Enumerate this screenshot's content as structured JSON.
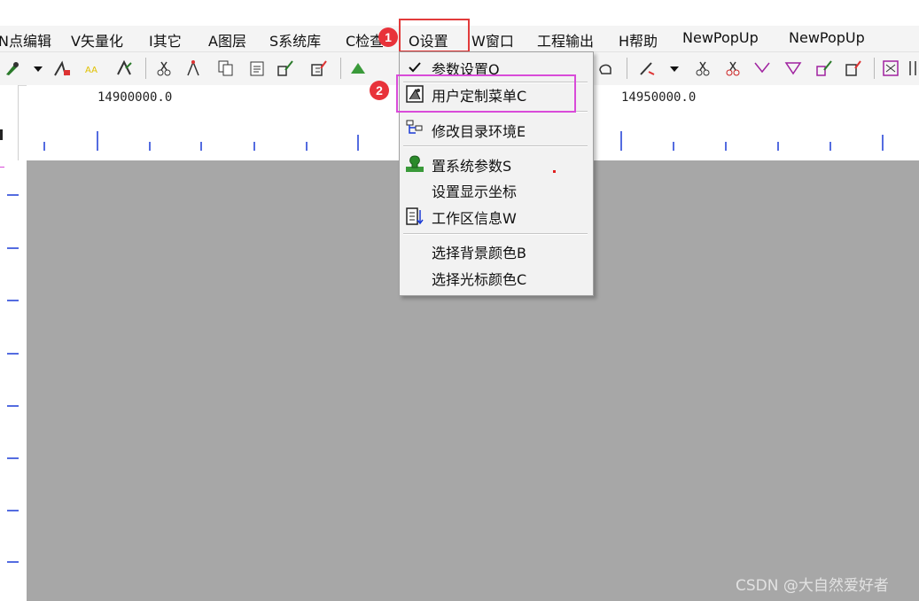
{
  "menubar": {
    "items": [
      {
        "label": "N点编辑"
      },
      {
        "label": "V矢量化"
      },
      {
        "label": "I其它"
      },
      {
        "label": "A图层"
      },
      {
        "label": "S系统库"
      },
      {
        "label": "C检查"
      },
      {
        "label": "O设置"
      },
      {
        "label": "W窗口"
      },
      {
        "label": "工程输出"
      },
      {
        "label": "H帮助"
      },
      {
        "label": "NewPopUp"
      },
      {
        "label": "NewPopUp"
      }
    ]
  },
  "ruler": {
    "labels": [
      "14900000.0",
      "14950000.0"
    ]
  },
  "dropdown": {
    "items": [
      {
        "label": "参数设置O",
        "checked": true
      },
      {
        "label": "用户定制菜单C"
      },
      {
        "label": "修改目录环境E"
      },
      {
        "label": "置系统参数S"
      },
      {
        "label": "设置显示坐标"
      },
      {
        "label": "工作区信息W"
      },
      {
        "label": "选择背景颜色B"
      },
      {
        "label": "选择光标颜色C"
      }
    ]
  },
  "annotations": {
    "step1": "1",
    "step2": "2"
  },
  "watermark": "CSDN @大自然爱好者",
  "colors": {
    "canvas": "#a7a7a7",
    "highlight_red": "#e23b3b",
    "highlight_magenta": "#d94bd9",
    "badge": "#e8323a"
  }
}
